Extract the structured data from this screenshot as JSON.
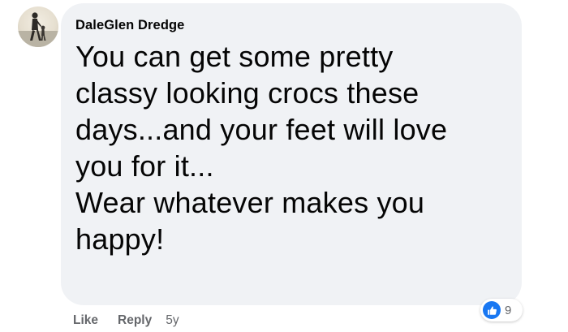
{
  "comment": {
    "author": "DaleGlen Dredge",
    "text": "You can get some pretty\nclassy looking crocs these\ndays...and your feet will love\nyou for it...\nWear whatever makes you\nhappy!",
    "avatar_icon": "profile-photo-person-walking"
  },
  "actions": {
    "like_label": "Like",
    "reply_label": "Reply",
    "timestamp": "5y"
  },
  "reactions": {
    "icon": "thumbs-up-icon",
    "count": "9",
    "color": "#1877f2"
  },
  "colors": {
    "bubble": "#f0f2f5",
    "text": "#050505",
    "secondary_text": "#65676b"
  }
}
